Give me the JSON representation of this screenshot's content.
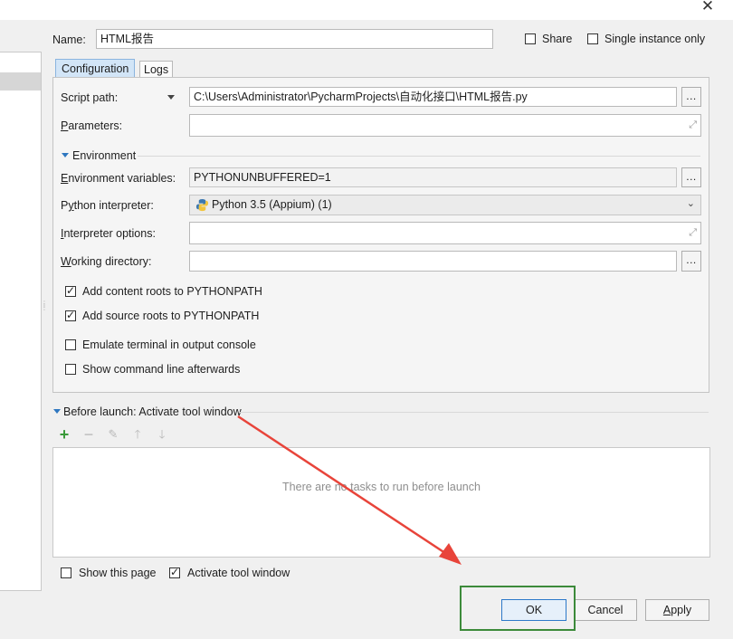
{
  "window": {
    "close_glyph": "✕"
  },
  "form": {
    "name_label": "Name:",
    "name_value": "HTML报告",
    "share_label": "Share",
    "share_checked": false,
    "single_instance_label": "Single instance only",
    "single_instance_checked": false
  },
  "tabs": [
    {
      "label": "Configuration",
      "active": true
    },
    {
      "label": "Logs",
      "active": false
    }
  ],
  "config": {
    "script_path_label": "Script path:",
    "script_path_value": "C:\\Users\\Administrator\\PycharmProjects\\自动化接口\\HTML报告.py",
    "browse_label": "...",
    "parameters_label": "Parameters:",
    "parameters_value": "",
    "environment_section": "Environment",
    "env_vars_label": "Environment variables:",
    "env_vars_value": "PYTHONUNBUFFERED=1",
    "interpreter_label": "Python interpreter:",
    "interpreter_value": "Python 3.5 (Appium) (1)",
    "interpreter_options_label": "Interpreter options:",
    "interpreter_options_value": "",
    "working_dir_label": "Working directory:",
    "working_dir_value": "",
    "checkboxes": [
      {
        "label": "Add content roots to PYTHONPATH",
        "checked": true
      },
      {
        "label": "Add source roots to PYTHONPATH",
        "checked": true
      },
      {
        "label": "Emulate terminal in output console",
        "checked": false
      },
      {
        "label": "Show command line afterwards",
        "checked": false
      }
    ]
  },
  "before_launch": {
    "title": "Before launch: Activate tool window",
    "empty_text": "There are no tasks to run before launch",
    "tools": [
      "add-icon",
      "remove-icon",
      "edit-icon",
      "move-up-icon",
      "move-down-icon"
    ]
  },
  "footer": {
    "show_page_label": "Show this page",
    "show_page_checked": false,
    "activate_tool_label": "Activate tool window",
    "activate_tool_checked": true,
    "ok_label": "OK",
    "cancel_label": "Cancel",
    "apply_label": "Apply"
  },
  "colors": {
    "accent": "#2e77c0",
    "annotation_red": "#e8443a",
    "annotation_green": "#3c8a3a",
    "add_green": "#3a9a3a"
  }
}
